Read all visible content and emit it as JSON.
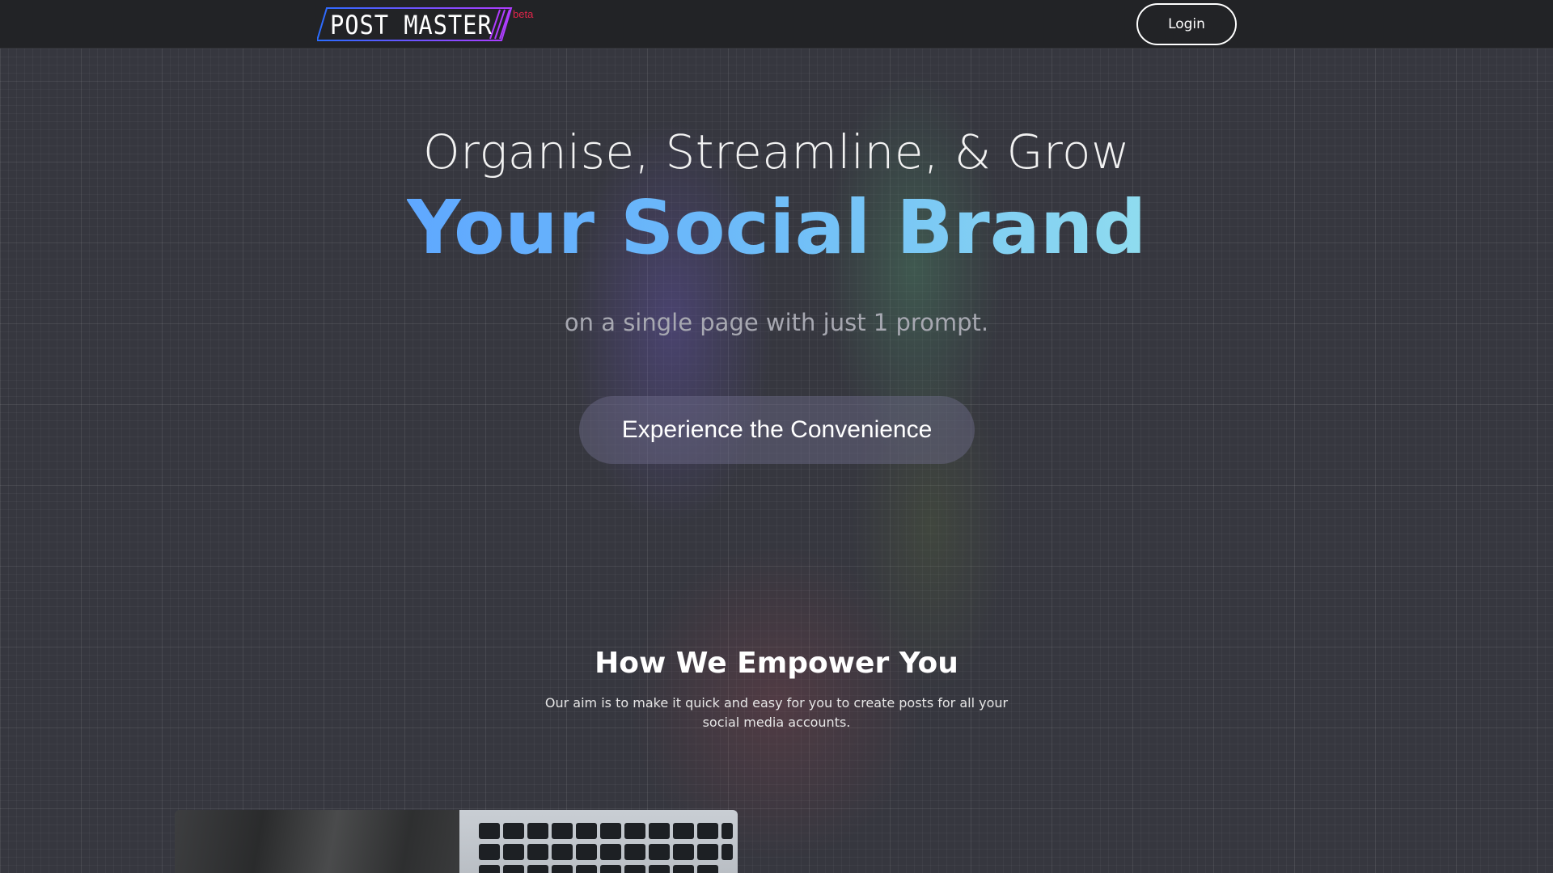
{
  "header": {
    "logo_text": "POST MASTER",
    "logo_badge": "beta",
    "login_label": "Login"
  },
  "hero": {
    "line1": "Organise, Streamline, & Grow",
    "line2": "Your Social Brand",
    "subtitle": "on a single page with just 1 prompt.",
    "cta_label": "Experience the Convenience"
  },
  "section": {
    "title": "How We Empower You",
    "description": "Our aim is to make it quick and easy for you to create posts for all your social media accounts."
  },
  "colors": {
    "header_bg": "#222326",
    "page_bg": "#36373f",
    "accent_gradient_start": "#5fa8ff",
    "accent_gradient_end": "#8fdcef",
    "beta_color": "#e0254a"
  },
  "icons": {
    "logo": "post-master-logo",
    "feature_image": "laptop-keyboard-photo"
  }
}
